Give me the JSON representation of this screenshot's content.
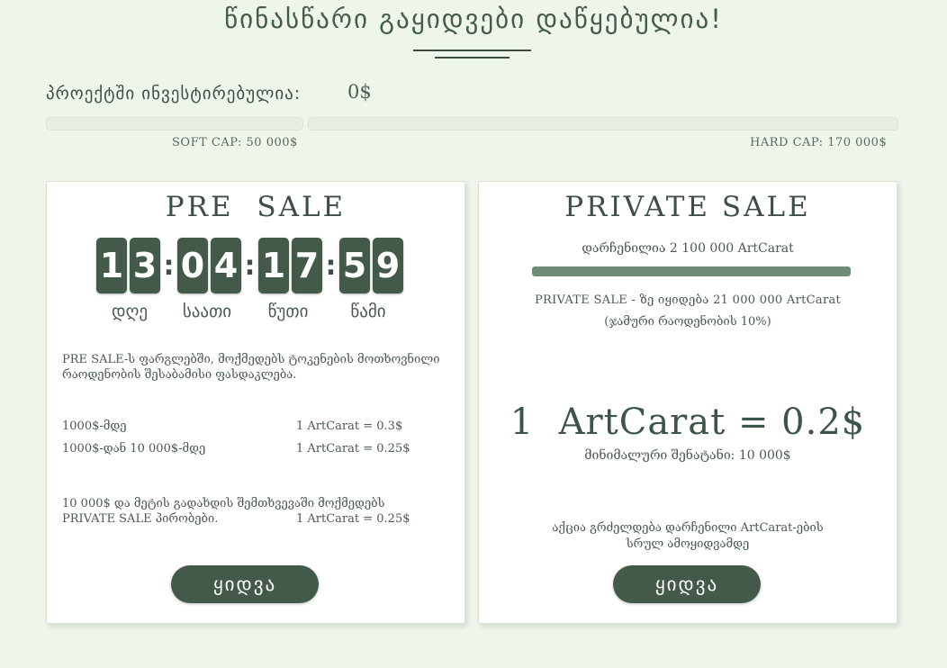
{
  "header": {
    "title": "წინასწარი გაყიდვები დაწყებულია!",
    "invested_label": "პროექტში ინვესტირებულია:",
    "invested_value": "0$",
    "soft_cap": "SOFT CAP:  50 000$",
    "hard_cap": "HARD CAP:  170 000$"
  },
  "presale": {
    "title": "PRE  SALE",
    "timer": {
      "days": [
        "1",
        "3"
      ],
      "hours": [
        "0",
        "4"
      ],
      "minutes": [
        "1",
        "7"
      ],
      "seconds": [
        "5",
        "9"
      ],
      "labels": [
        "დღე",
        "საათი",
        "წუთი",
        "წამი"
      ]
    },
    "description_line1": "PRE SALE-ს ფარგლებში, მოქმედებს ტოკენების მოთხოვნილი",
    "description_line2": "რაოდენობის შესაბამისი ფასდაკლება.",
    "tiers": [
      {
        "range": "1000$-მდე",
        "rate": "1 ArtCarat = 0.3$"
      },
      {
        "range": "1000$-დან 10 000$-მდე",
        "rate": "1 ArtCarat = 0.25$"
      }
    ],
    "note_line1": "10 000$ და მეტის გადახდის შემთხვევაში მოქმედებს",
    "note_line2": "PRIVATE SALE პირობები.",
    "note_rate": "1 ArtCarat = 0.25$",
    "buy_label": "ყიდვა"
  },
  "private_sale": {
    "title": "PRIVATE SALE",
    "remaining": "დარჩენილია 2 100 000 ArtCarat",
    "progress_fraction": 1.0,
    "offer_line1": "PRIVATE  SALE - ზე იყიდება  21 000 000 ArtCarat",
    "offer_line2": "(ჯამური რაოდენობის 10%)",
    "rate": "1  ArtCarat = 0.2$",
    "min_investment": "მინიმალური შენატანი: 10 000$",
    "footer_line1": "აქცია გრძელდება დარჩენილი ArtCarat-ების",
    "footer_line2": "სრულ ამოყიდვამდე",
    "buy_label": "ყიდვა"
  },
  "colors": {
    "background": "#eef6ec",
    "accent": "#435a4b",
    "progress": "#6f8b77"
  }
}
